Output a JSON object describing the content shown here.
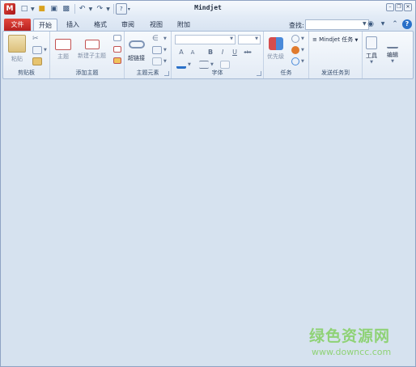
{
  "window": {
    "title": "Mindjet"
  },
  "quick_access": [
    "file-new-icon",
    "open-folder-icon",
    "save-icon",
    "print-icon",
    "undo-icon",
    "redo-icon",
    "help-small-icon"
  ],
  "tabs": {
    "file": "文件",
    "items": [
      "开始",
      "插入",
      "格式",
      "审阅",
      "视图",
      "附加"
    ],
    "active": "开始"
  },
  "find": {
    "label": "查找:",
    "value": ""
  },
  "ribbon": {
    "clipboard": {
      "paste_label": "粘贴",
      "group_label": "剪贴板"
    },
    "add_topic": {
      "topic_label": "主题",
      "subtopic_label": "新建子主题",
      "group_label": "添加主题"
    },
    "topic_elements": {
      "hyperlink_label": "超链接",
      "group_label": "主题元素"
    },
    "font": {
      "bold": "B",
      "italic": "I",
      "underline": "U",
      "strike": "abc",
      "grow": "A",
      "shrink": "A",
      "group_label": "字体"
    },
    "task": {
      "priority_label": "优先级",
      "group_label": "任务"
    },
    "send_task": {
      "mindjet_task_label": "Mindjet 任务",
      "group_label": "发送任务到"
    },
    "tools": {
      "tools_label": "工具",
      "edit_label": "编辑"
    }
  },
  "watermark": {
    "title": "绿色资源网",
    "url": "www.downcc.com"
  },
  "colors": {
    "file_tab": "#c8231f",
    "canvas": "#d6e2ef",
    "watermark": "#8fd276"
  }
}
